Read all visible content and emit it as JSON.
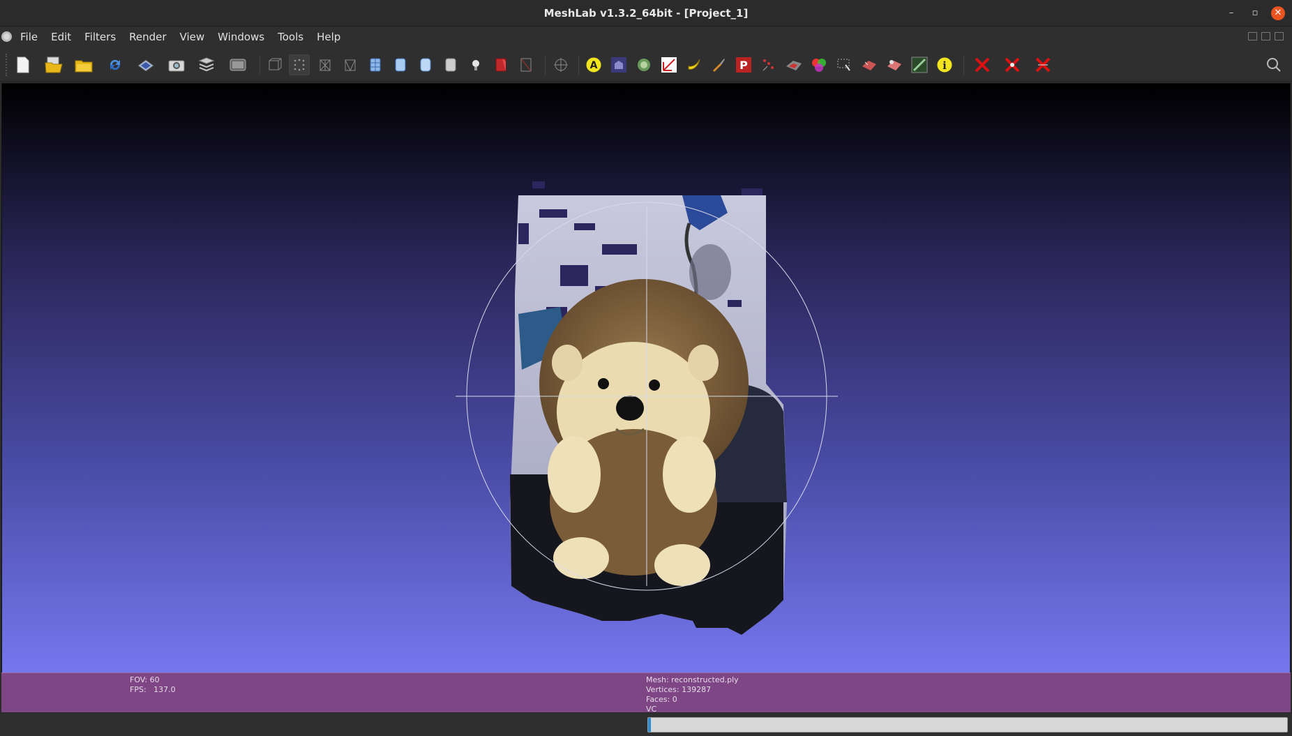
{
  "window": {
    "title": "MeshLab v1.3.2_64bit - [Project_1]",
    "minimize_glyph": "–",
    "maximize_glyph": "▫",
    "close_glyph": "✕"
  },
  "menu": {
    "items": [
      "File",
      "Edit",
      "Filters",
      "Render",
      "View",
      "Windows",
      "Tools",
      "Help"
    ]
  },
  "toolbar": {
    "icons": [
      "new-project-icon",
      "open-project-icon",
      "import-mesh-icon",
      "reload-icon",
      "export-mesh-icon",
      "snapshot-icon",
      "layers-icon",
      "raster-icon",
      "bounding-box-icon",
      "points-icon",
      "wireframe-icon",
      "hidden-lines-icon",
      "flat-lines-icon",
      "flat-icon",
      "smooth-icon",
      "texture-icon",
      "light-icon",
      "backface-icon",
      "double-side-icon",
      "trackball-icon",
      "annotation-icon",
      "align-icon",
      "sample-icon",
      "measure-icon",
      "banana-icon",
      "paint-icon",
      "pick-points-icon",
      "select-vertex-icon",
      "select-face-icon",
      "color-icon",
      "select-region-icon",
      "select-connected-icon",
      "mesh-art-icon",
      "texture-param-icon",
      "info-icon",
      "delete-vertex-icon",
      "delete-face-icon",
      "delete-selected-icon"
    ],
    "search_icon": "search-icon"
  },
  "viewport": {
    "background_top": "#000000",
    "background_bottom": "#7577ee"
  },
  "info_left": {
    "fov": "FOV: 60",
    "fps": "FPS:   137.0"
  },
  "info_right": {
    "mesh": "Mesh: reconstructed.ply",
    "vertices": "Vertices: 139287",
    "faces": "Faces: 0",
    "mode": "VC"
  },
  "status": {
    "progress_fraction": 0.004
  }
}
